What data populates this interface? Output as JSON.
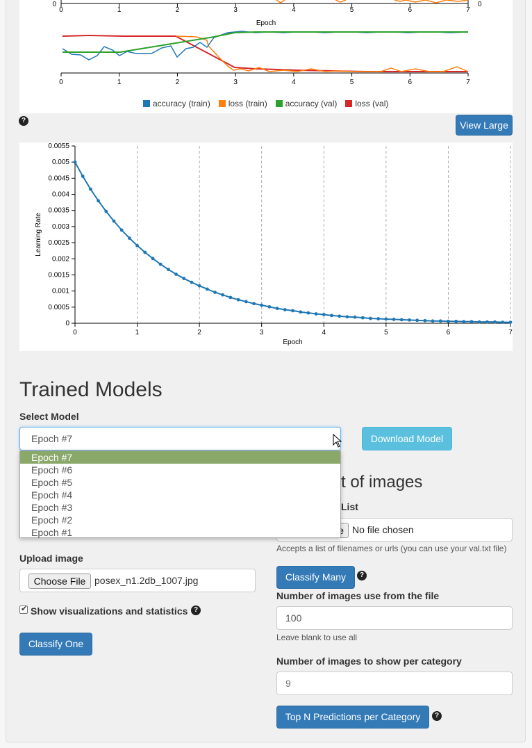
{
  "top_chart": {
    "x_axis_label": "Epoch",
    "x_ticks": [
      "0",
      "1",
      "2",
      "3",
      "4",
      "5",
      "6",
      "7"
    ],
    "right_axis_zero": "0",
    "left_axis_zero": "0",
    "legend": [
      {
        "label": "accuracy (train)",
        "color": "#1f77b4"
      },
      {
        "label": "loss (train)",
        "color": "#ff7f0e"
      },
      {
        "label": "accuracy (val)",
        "color": "#2ca02c"
      },
      {
        "label": "loss (val)",
        "color": "#d62728"
      }
    ]
  },
  "view_large_label": "View Large",
  "chart_data": {
    "type": "line",
    "title": "",
    "xlabel": "Epoch",
    "ylabel": "Learning Rate",
    "xlim": [
      0,
      7
    ],
    "ylim": [
      0,
      0.0055
    ],
    "x_ticks": [
      "0",
      "1",
      "2",
      "3",
      "4",
      "5",
      "6",
      "7"
    ],
    "y_ticks": [
      "0",
      "0.0005",
      "0.001",
      "0.0015",
      "0.002",
      "0.0025",
      "0.003",
      "0.0035",
      "0.004",
      "0.0045",
      "0.005",
      "0.0055"
    ],
    "grid": "vertical dashed",
    "series": [
      {
        "color": "#1f77b4",
        "x": [
          0,
          0.125,
          0.25,
          0.375,
          0.5,
          0.625,
          0.75,
          0.875,
          1,
          1.125,
          1.25,
          1.375,
          1.5,
          1.625,
          1.75,
          1.875,
          2,
          2.125,
          2.25,
          2.375,
          2.5,
          2.625,
          2.75,
          2.875,
          3,
          3.125,
          3.25,
          3.375,
          3.5,
          3.625,
          3.75,
          3.875,
          4,
          4.125,
          4.25,
          4.375,
          4.5,
          4.625,
          4.75,
          4.875,
          5,
          5.125,
          5.25,
          5.375,
          5.5,
          5.625,
          5.75,
          5.875,
          6,
          6.125,
          6.25,
          6.375,
          6.5,
          6.625,
          6.75,
          6.875,
          7
        ],
        "y": [
          0.005,
          0.00456,
          0.00416,
          0.0038,
          0.00347,
          0.00317,
          0.00289,
          0.00264,
          0.00241,
          0.0022,
          0.00201,
          0.00183,
          0.00167,
          0.00152,
          0.00139,
          0.00127,
          0.00116,
          0.00106,
          0.00096,
          0.00088,
          0.0008,
          0.00073,
          0.00067,
          0.00061,
          0.00056,
          0.00051,
          0.00046,
          0.00042,
          0.00039,
          0.00035,
          0.00032,
          0.00029,
          0.00027,
          0.00024,
          0.00022,
          0.0002,
          0.00019,
          0.00017,
          0.00015,
          0.00014,
          0.00013,
          0.00012,
          0.00011,
          0.0001,
          9e-05,
          8e-05,
          7e-05,
          7e-05,
          6e-05,
          6e-05,
          5e-05,
          5e-05,
          4e-05,
          4e-05,
          4e-05,
          3e-05,
          3e-05
        ]
      }
    ]
  },
  "trained_models": {
    "heading": "Trained Models",
    "select_label": "Select Model",
    "selected": "Epoch #7",
    "options": [
      "Epoch #7",
      "Epoch #6",
      "Epoch #5",
      "Epoch #4",
      "Epoch #3",
      "Epoch #2",
      "Epoch #1"
    ],
    "download_label": "Download Model"
  },
  "single": {
    "upload_label": "Upload image",
    "choose_file": "Choose File",
    "file_name": "posex_n1.2db_1007.jpg",
    "show_viz_label": "Show visualizations and statistics",
    "show_viz_checked": true,
    "classify_one": "Classify One"
  },
  "multi": {
    "heading_partial": "t of images",
    "list_label_partial": "List",
    "choose_file_partial": "e",
    "no_file": "No file chosen",
    "accepts_hint": "Accepts a list of filenames or urls (you can use your val.txt file)",
    "classify_many": "Classify Many",
    "num_images_label": "Number of images use from the file",
    "num_images_value": "100",
    "leave_blank": "Leave blank to use all",
    "per_category_label": "Number of images to show per category",
    "per_category_placeholder": "9",
    "top_n": "Top N Predictions per Category"
  },
  "help_glyph": "?"
}
